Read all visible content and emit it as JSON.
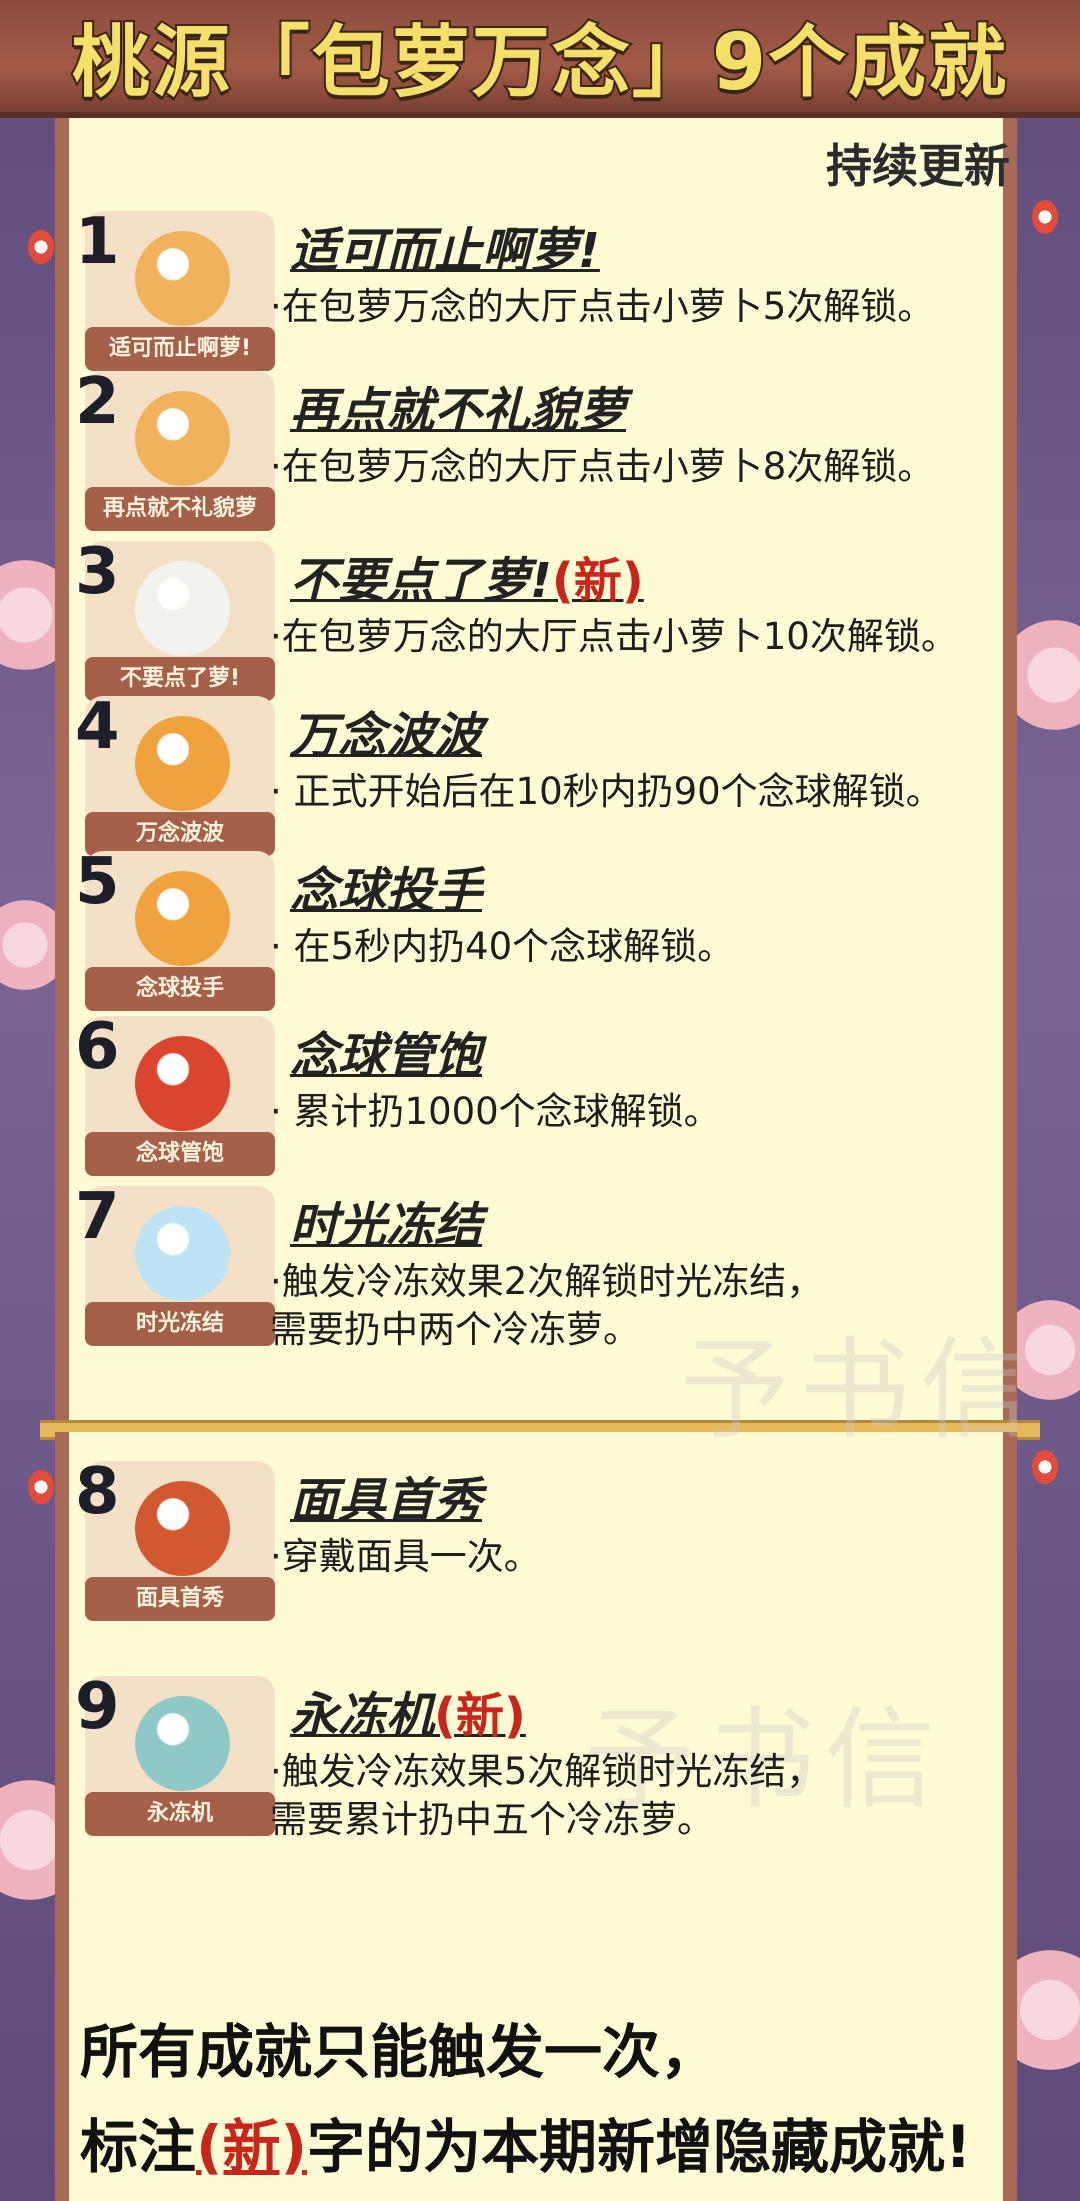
{
  "header": {
    "title": "桃源「包萝万念」9个成就"
  },
  "subtitle": "持续更新",
  "new_tag": "(新)",
  "achievements": [
    {
      "num": "1",
      "name": "适可而止啊萝!",
      "badge": "适可而止啊萝!",
      "desc1": "·在包萝万念的大厅点击小萝卜5次解锁。",
      "desc2": "",
      "is_new": false,
      "icon": "bunny-icon",
      "color": "#f2b25d"
    },
    {
      "num": "2",
      "name": "再点就不礼貌萝",
      "badge": "再点就不礼貌萝",
      "desc1": "·在包萝万念的大厅点击小萝卜8次解锁。",
      "desc2": "",
      "is_new": false,
      "icon": "bunny-icon",
      "color": "#f2b25d"
    },
    {
      "num": "3",
      "name": "不要点了萝!",
      "badge": "不要点了萝!",
      "desc1": "·在包萝万念的大厅点击小萝卜10次解锁。",
      "desc2": "",
      "is_new": true,
      "icon": "official-icon",
      "color": "#f4f2ee"
    },
    {
      "num": "4",
      "name": "万念波波",
      "badge": "万念波波",
      "desc1": "· 正式开始后在10秒内扔90个念球解锁。",
      "desc2": "",
      "is_new": false,
      "icon": "ball-icon",
      "color": "#f0a23e"
    },
    {
      "num": "5",
      "name": "念球投手",
      "badge": "念球投手",
      "desc1": "· 在5秒内扔40个念球解锁。",
      "desc2": "",
      "is_new": false,
      "icon": "ball-icon",
      "color": "#f0a23e"
    },
    {
      "num": "6",
      "name": "念球管饱",
      "badge": "念球管饱",
      "desc1": "· 累计扔1000个念球解锁。",
      "desc2": "",
      "is_new": false,
      "icon": "pot-icon",
      "color": "#d9452e"
    },
    {
      "num": "7",
      "name": "时光冻结",
      "badge": "时光冻结",
      "desc1": "·触发冷冻效果2次解锁时光冻结，",
      "desc2": "需要扔中两个冷冻萝。",
      "is_new": false,
      "icon": "ice-icon",
      "color": "#bde3f5"
    },
    {
      "num": "8",
      "name": "面具首秀",
      "badge": "面具首秀",
      "desc1": "·穿戴面具一次。",
      "desc2": "",
      "is_new": false,
      "icon": "mask-icon",
      "color": "#d2582f"
    },
    {
      "num": "9",
      "name": "永冻机",
      "badge": "永冻机",
      "desc1": "·触发冷冻效果5次解锁时光冻结，",
      "desc2": "需要累计扔中五个冷冻萝。",
      "is_new": true,
      "icon": "frozen-icon",
      "color": "#8fc9c8"
    }
  ],
  "watermark": "予书信",
  "footer": {
    "line1": "所有成就只能触发一次，",
    "line2_pre": "标注",
    "line2_tag": "(新)",
    "line2_post": "字的为本期新增隐藏成就!"
  }
}
